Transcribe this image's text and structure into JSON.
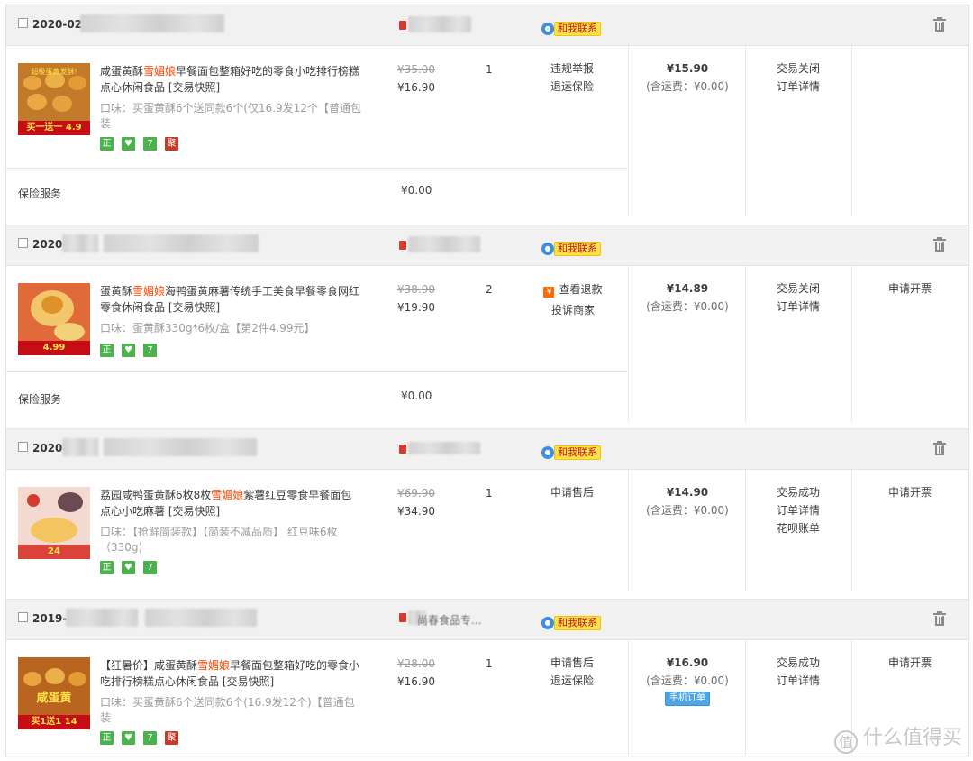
{
  "contact_label": "和我联系",
  "insurance_label": "保险服务",
  "orders": [
    {
      "date": "2020-02-",
      "title_pre": "咸蛋黄酥",
      "title_brand": "雪媚娘",
      "title_post": "早餐面包整箱好吃的零食小吃排行榜糕点心休闲食品 [交易快照]",
      "spec": "口味：买蛋黄酥6个送同款6个(仅16.9发12个【普通包装",
      "orig_price": "¥35.00",
      "price": "¥16.90",
      "qty": "1",
      "ops": [
        "违规举报",
        "退运保险"
      ],
      "total": "¥15.90",
      "shipping": "(含运费：¥0.00)",
      "status": [
        "交易关闭",
        "订单详情"
      ],
      "invoice": "",
      "insurance_value": "¥0.00",
      "thumb_caption": "买一送一 4.9",
      "thumb_top": "超级蛋黄发酥!"
    },
    {
      "date": "2020-",
      "title_pre": "蛋黄酥",
      "title_brand": "雪媚娘",
      "title_post": "海鸭蛋黄麻薯传统手工美食早餐零食网红零食休闲食品 [交易快照]",
      "spec": "口味：蛋黄酥330g*6枚/盒【第2件4.99元】",
      "orig_price": "¥38.90",
      "price": "¥19.90",
      "qty": "2",
      "ops": [
        "查看退款",
        "投诉商家"
      ],
      "total": "¥14.89",
      "shipping": "(含运费：¥0.00)",
      "status": [
        "交易关闭",
        "订单详情"
      ],
      "invoice": "申请开票",
      "insurance_value": "¥0.00",
      "thumb_caption": "4.99",
      "thumb_top": ""
    },
    {
      "date": "2020-",
      "title_pre": "荔园咸鸭蛋黄酥6枚8枚",
      "title_brand": "雪媚娘",
      "title_post": "紫薯红豆零食早餐面包点心小吃麻薯 [交易快照]",
      "spec": "口味：【抢鲜简装款】【简装不减品质】 红豆味6枚（330g)",
      "orig_price": "¥69.90",
      "price": "¥34.90",
      "qty": "1",
      "ops": [
        "申请售后"
      ],
      "total": "¥14.90",
      "shipping": "(含运费：¥0.00)",
      "status": [
        "交易成功",
        "订单详情",
        "花呗账单"
      ],
      "invoice": "申请开票",
      "thumb_caption": "24",
      "thumb_top": ""
    },
    {
      "date": "2019-",
      "shop_visible": "尚春食品专...",
      "title_pre": "【狂暑价】咸蛋黄酥",
      "title_brand": "雪媚娘",
      "title_post": "早餐面包整箱好吃的零食小吃排行榜糕点心休闲食品 [交易快照]",
      "spec": "口味：买蛋黄酥6个送同款6个(16.9发12个)【普通包装",
      "orig_price": "¥28.00",
      "price": "¥16.90",
      "qty": "1",
      "ops": [
        "申请售后",
        "退运保险"
      ],
      "total": "¥16.90",
      "shipping": "(含运费：¥0.00)",
      "mobile_tag": "手机订单",
      "status": [
        "交易成功",
        "订单详情"
      ],
      "invoice": "申请开票",
      "thumb_caption": "买1送1 14",
      "thumb_top": "咸蛋黄"
    }
  ],
  "badges": {
    "zheng": "正",
    "seven": "7",
    "ju": "聚"
  },
  "watermark": "什么值得买",
  "colors": {
    "brand_highlight": "#ff4400",
    "contact_bg": "#ffe14d",
    "contact_text": "#c2161b"
  }
}
